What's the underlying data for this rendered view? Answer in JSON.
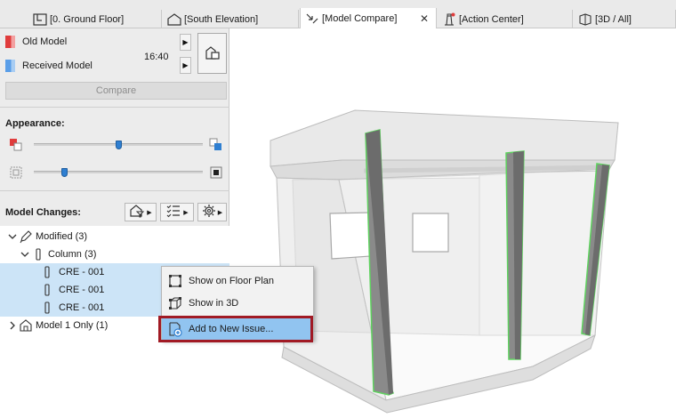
{
  "tabs": [
    {
      "label": "[0. Ground Floor]"
    },
    {
      "label": "[South Elevation]"
    },
    {
      "label": "[Model Compare]",
      "close": "✕"
    },
    {
      "label": "[Action Center]"
    },
    {
      "label": "[3D / All]"
    }
  ],
  "panel": {
    "old_model_label": "Old Model",
    "received_model_label": "Received Model",
    "time": "16:40",
    "old_color": "#e03c3c",
    "received_color": "#5a9ee8",
    "compare_label": "Compare",
    "appearance_title": "Appearance:",
    "slider1_value": 0.5,
    "slider2_value": 0.18,
    "model_changes_title": "Model Changes:"
  },
  "tree": {
    "modified": "Modified (3)",
    "column": "Column (3)",
    "items": [
      "CRE - 001",
      "CRE - 001",
      "CRE - 001"
    ],
    "model1_only": "Model 1 Only (1)"
  },
  "context_menu": {
    "items": [
      "Show on Floor Plan",
      "Show in 3D",
      "Add to New Issue..."
    ]
  },
  "colors": {
    "accent": "#2f7fd1",
    "selection": "#cce4f7",
    "menu_highlight": "#91c4f0",
    "callout": "#a11a24",
    "changed_element": "#5fd35f"
  }
}
